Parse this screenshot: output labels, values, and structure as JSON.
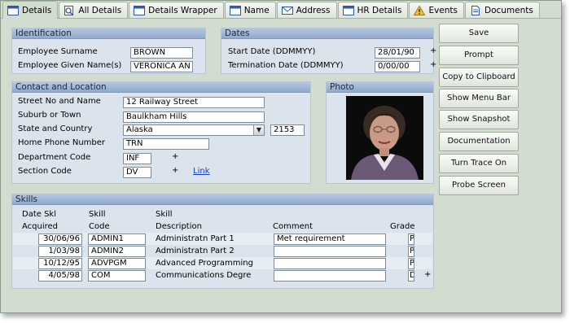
{
  "tabs": [
    {
      "label": "Details",
      "icon": "window-icon",
      "active": true
    },
    {
      "label": "All Details",
      "icon": "search-icon"
    },
    {
      "label": "Details Wrapper",
      "icon": "window-icon"
    },
    {
      "label": "Name",
      "icon": "window-icon"
    },
    {
      "label": "Address",
      "icon": "envelope-icon"
    },
    {
      "label": "HR Details",
      "icon": "window-icon"
    },
    {
      "label": "Events",
      "icon": "warning-icon"
    },
    {
      "label": "Documents",
      "icon": "document-icon"
    }
  ],
  "identification": {
    "title": "Identification",
    "surname_label": "Employee Surname",
    "surname_value": "BROWN",
    "given_label": "Employee Given Name(s)",
    "given_value": "VERONICA AN"
  },
  "dates": {
    "title": "Dates",
    "start_label": "Start Date (DDMMYY)",
    "start_value": "28/01/90",
    "term_label": "Termination Date (DDMMYY)",
    "term_value": "0/00/00",
    "plus": "+"
  },
  "contact": {
    "title": "Contact and Location",
    "street_label": "Street No and Name",
    "street_value": "12 Railway Street",
    "suburb_label": "Suburb or Town",
    "suburb_value": "Baulkham Hills",
    "state_label": "State and Country",
    "state_value": "Alaska",
    "postcode_value": "2153",
    "phone_label": "Home Phone Number",
    "phone_value": "TRN",
    "dept_label": "Department Code",
    "dept_value": "INF",
    "section_label": "Section Code",
    "section_value": "DV",
    "plus": "+",
    "link_label": "Link"
  },
  "photo": {
    "title": "Photo"
  },
  "buttons": [
    "Save",
    "Prompt",
    "Copy to Clipboard",
    "Show Menu Bar",
    "Show Snapshot",
    "Documentation",
    "Turn Trace On",
    "Probe Screen"
  ],
  "skills": {
    "title": "Skills",
    "headers": {
      "date_1": "Date Skl",
      "date_2": "Acquired",
      "code_1": "Skill",
      "code_2": "Code",
      "desc_1": "Skill",
      "desc_2": "Description",
      "comment": "Comment",
      "grade": "Grade"
    },
    "rows": [
      {
        "date": "30/06/96",
        "code": "ADMIN1",
        "desc": "Administratn Part 1",
        "comment": "Met requirement",
        "grade": "P"
      },
      {
        "date": "1/03/98",
        "code": "ADMIN2",
        "desc": "Administratn Part 2",
        "comment": "",
        "grade": "P"
      },
      {
        "date": "10/12/95",
        "code": "ADVPGM",
        "desc": "Advanced Programming",
        "comment": "",
        "grade": "P"
      },
      {
        "date": "4/05/98",
        "code": "COM",
        "desc": "Communications Degre",
        "comment": "",
        "grade": "D"
      }
    ],
    "plus": "+"
  }
}
